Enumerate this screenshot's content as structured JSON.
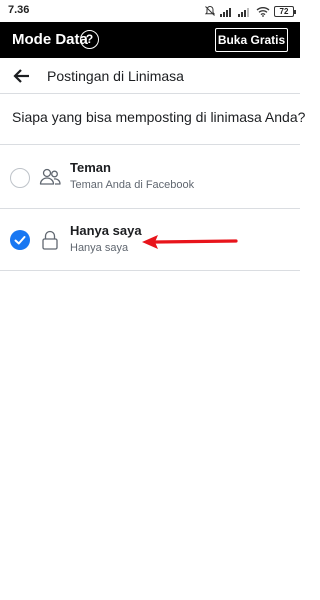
{
  "status_bar": {
    "time": "7.36",
    "battery": "72"
  },
  "data_mode_bar": {
    "title": "Mode Data",
    "help_icon": "question-circle-icon",
    "free_button_label": "Buka Gratis"
  },
  "header": {
    "back_icon": "arrow-left-icon",
    "title": "Postingan di Linimasa"
  },
  "question": "Siapa yang bisa memposting di linimasa Anda?",
  "options": [
    {
      "label": "Teman",
      "sublabel": "Teman Anda di Facebook",
      "icon": "friends-icon",
      "selected": false
    },
    {
      "label": "Hanya saya",
      "sublabel": "Hanya saya",
      "icon": "lock-icon",
      "selected": true
    }
  ],
  "colors": {
    "accent": "#1877f2",
    "annotation_arrow": "#e8141b",
    "mode_bar_bg": "#000000"
  }
}
